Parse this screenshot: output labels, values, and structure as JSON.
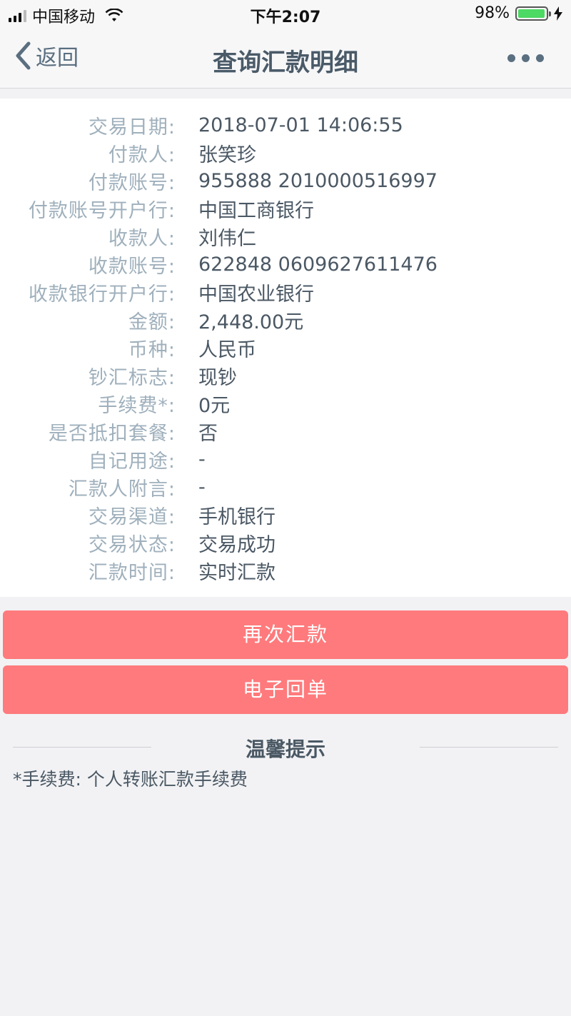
{
  "status_bar": {
    "carrier": "中国移动",
    "time": "下午2:07",
    "battery": "98%",
    "battery_level": 0.98
  },
  "nav": {
    "back_label": "返回",
    "title": "查询汇款明细",
    "back_icon": "chevron-left-icon",
    "more_icon": "more-dots-icon"
  },
  "details": [
    {
      "label": "交易日期:",
      "value": "2018-07-01 14:06:55"
    },
    {
      "label": "付款人:",
      "value": "张笑珍"
    },
    {
      "label": "付款账号:",
      "value": "955888 2010000516997"
    },
    {
      "label": "付款账号开户行:",
      "value": "中国工商银行"
    },
    {
      "label": "收款人:",
      "value": "刘伟仁"
    },
    {
      "label": "收款账号:",
      "value": "622848 0609627611476"
    },
    {
      "label": "收款银行开户行:",
      "value": "中国农业银行"
    },
    {
      "label": "金额:",
      "value": "2,448.00元"
    },
    {
      "label": "币种:",
      "value": "人民币"
    },
    {
      "label": "钞汇标志:",
      "value": "现钞"
    },
    {
      "label": "手续费*:",
      "value": "0元"
    },
    {
      "label": "是否抵扣套餐:",
      "value": "否"
    },
    {
      "label": "自记用途:",
      "value": "-"
    },
    {
      "label": "汇款人附言:",
      "value": "-"
    },
    {
      "label": "交易渠道:",
      "value": "手机银行"
    },
    {
      "label": "交易状态:",
      "value": "交易成功"
    },
    {
      "label": "汇款时间:",
      "value": "实时汇款"
    }
  ],
  "actions": {
    "remit_again": "再次汇款",
    "e_receipt": "电子回单",
    "button_color": "#fe7a7c"
  },
  "tips": {
    "title": "温馨提示",
    "text": "*手续费: 个人转账汇款手续费"
  }
}
